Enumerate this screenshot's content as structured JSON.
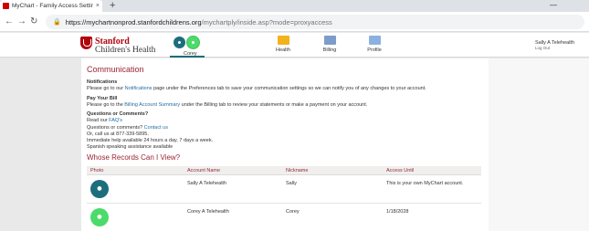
{
  "browser": {
    "tab_title": "MyChart - Family Access Settings",
    "tab_close": "×",
    "new_tab": "+",
    "minimize": "—",
    "back": "←",
    "forward": "→",
    "reload": "↻",
    "url_host": "https://mychartnonprod.stanfordchildrens.org",
    "url_path": "/mychartply/inside.asp?mode=proxyaccess"
  },
  "header": {
    "logo_line1": "Stanford",
    "logo_line2": "Children's Health",
    "active_proxy_label": "Corey",
    "nav": [
      {
        "label": "Health",
        "icon": "heart-icon"
      },
      {
        "label": "Billing",
        "icon": "billing-icon"
      },
      {
        "label": "Profile",
        "icon": "profile-icon"
      }
    ],
    "user_name": "Sally A Telehealth",
    "logout_label": "Log Out"
  },
  "communication": {
    "title": "Communication",
    "notifications_heading": "Notifications",
    "notifications_pre": "Please go to our ",
    "notifications_link": "Notifications",
    "notifications_post": " page under the Preferences tab to save your communication settings so we can notify you of any changes to your account.",
    "paybill_heading": "Pay Your Bill",
    "paybill_pre": "Please go to the ",
    "paybill_link": "Billing Account Summary",
    "paybill_post": " under the Billing tab to review your statements or make a payment on your account.",
    "questions_heading": "Questions or Comments?",
    "read_pre": "Read our ",
    "faq_link": "FAQ's",
    "questions_pre": "Questions or comments? ",
    "contact_link": "Contact us",
    "call_line": "Or, call us at 877-339-5895.",
    "hours_line": "Immediate help available 24 hours a day, 7 days a week.",
    "spanish_line": "Spanish speaking assistance available"
  },
  "records": {
    "title": "Whose Records Can I View?",
    "columns": [
      "Photo",
      "Account Name",
      "Nickname",
      "Access Until"
    ],
    "rows": [
      {
        "account_name": "Sally A Telehealth",
        "nickname": "Sally",
        "access_until": "This is your own MyChart account."
      },
      {
        "account_name": "Corey A Telehealth",
        "nickname": "Corey",
        "access_until": "1/18/2028"
      }
    ]
  },
  "colors": {
    "brand_red": "#b1040e",
    "heading_maroon": "#9b2335",
    "link_blue": "#1d6fa5",
    "avatar_teal": "#1c6e7d",
    "avatar_green": "#4cdb6b"
  }
}
